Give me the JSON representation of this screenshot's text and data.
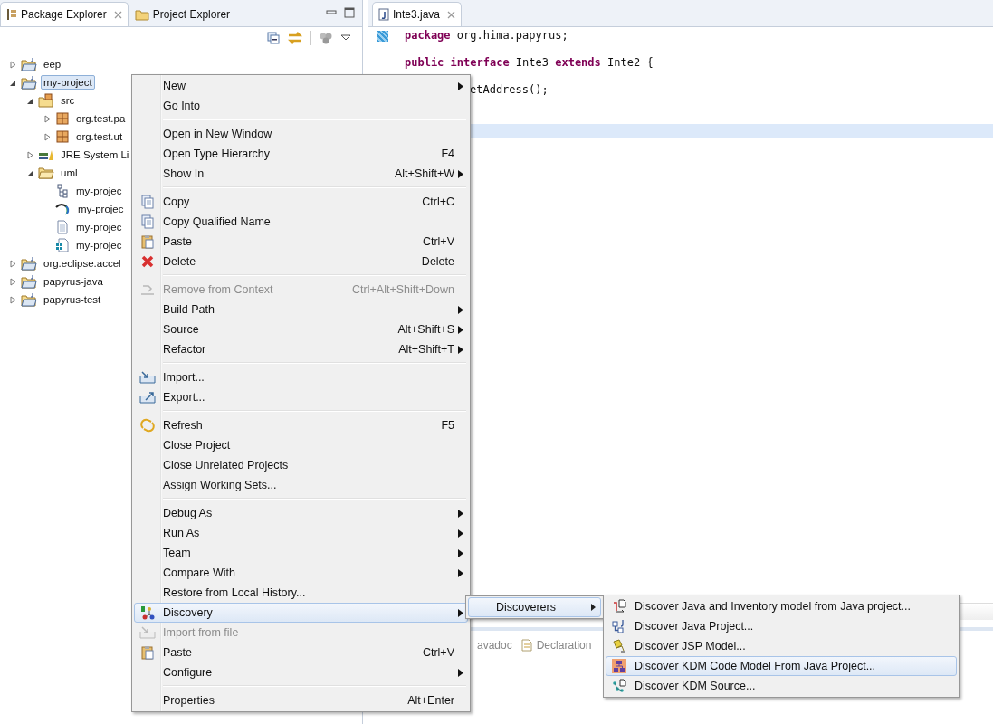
{
  "explorer": {
    "tabs": [
      {
        "label": "Package Explorer",
        "selected": true,
        "closable": true
      },
      {
        "label": "Project Explorer",
        "selected": false,
        "closable": false
      }
    ],
    "tree": [
      {
        "label": "eep",
        "kind": "project",
        "expanded": false,
        "selected": false
      },
      {
        "label": "my-project",
        "kind": "project",
        "expanded": true,
        "selected": true,
        "children": [
          {
            "label": "src",
            "kind": "source-folder",
            "expanded": true,
            "selected": false,
            "children": [
              {
                "label": "org.test.pa",
                "kind": "package",
                "expanded": false,
                "selected": false
              },
              {
                "label": "org.test.ut",
                "kind": "package",
                "expanded": false,
                "selected": false
              }
            ]
          },
          {
            "label": "JRE System Li",
            "kind": "library",
            "expanded": false,
            "selected": false
          },
          {
            "label": "uml",
            "kind": "folder",
            "expanded": true,
            "selected": false,
            "children": [
              {
                "label": "my-projec",
                "kind": "diagram",
                "selected": false
              },
              {
                "label": "my-projec",
                "kind": "model",
                "selected": false
              },
              {
                "label": "my-projec",
                "kind": "file",
                "selected": false
              },
              {
                "label": "my-projec",
                "kind": "notation",
                "selected": false
              }
            ]
          }
        ]
      },
      {
        "label": "org.eclipse.accel",
        "kind": "project",
        "expanded": false,
        "selected": false
      },
      {
        "label": "papyrus-java",
        "kind": "project",
        "expanded": false,
        "selected": false
      },
      {
        "label": "papyrus-test",
        "kind": "project",
        "expanded": false,
        "selected": false
      }
    ]
  },
  "editor": {
    "tab": {
      "label": "Inte3.java",
      "selected": true,
      "closable": true
    },
    "lines": [
      {
        "kind": "code",
        "current": false,
        "segments": [
          {
            "text": "package",
            "keyword": true
          },
          {
            "text": "org.hima.papyrus;",
            "keyword": false
          }
        ]
      },
      {
        "kind": "blank",
        "current": false
      },
      {
        "kind": "code",
        "current": false,
        "segments": [
          {
            "text": "public",
            "keyword": true
          },
          {
            "text": "interface",
            "keyword": true
          },
          {
            "text": "Inte3",
            "keyword": false
          },
          {
            "text": "extends",
            "keyword": true
          },
          {
            "text": "Inte2 {",
            "keyword": false
          }
        ]
      },
      {
        "kind": "blank",
        "current": false
      },
      {
        "kind": "partial",
        "current": false,
        "segments": [
          {
            "text": "etAddress();",
            "keyword": false
          }
        ]
      },
      {
        "kind": "blank",
        "current": false
      },
      {
        "kind": "blank",
        "current": false
      },
      {
        "kind": "blank",
        "current": true
      }
    ],
    "bottom_tabs": [
      {
        "label": "avadoc",
        "kind": "partial",
        "selected": false
      },
      {
        "label": "Declaration",
        "kind": "full",
        "selected": false
      }
    ]
  },
  "context_menu": {
    "groups": [
      [
        {
          "label": "New",
          "submenu": true,
          "disabled": false,
          "selected": false
        },
        {
          "label": "Go Into",
          "submenu": false,
          "disabled": false,
          "selected": false
        }
      ],
      [
        {
          "label": "Open in New Window",
          "submenu": false,
          "disabled": false,
          "selected": false
        },
        {
          "label": "Open Type Hierarchy",
          "shortcut": "F4",
          "submenu": false,
          "disabled": false,
          "selected": false
        },
        {
          "label": "Show In",
          "shortcut": "Alt+Shift+W",
          "submenu": true,
          "disabled": false,
          "selected": false
        }
      ],
      [
        {
          "label": "Copy",
          "shortcut": "Ctrl+C",
          "submenu": false,
          "disabled": false,
          "selected": false
        },
        {
          "label": "Copy Qualified Name",
          "submenu": false,
          "disabled": false,
          "selected": false
        },
        {
          "label": "Paste",
          "shortcut": "Ctrl+V",
          "submenu": false,
          "disabled": false,
          "selected": false
        },
        {
          "label": "Delete",
          "shortcut": "Delete",
          "submenu": false,
          "disabled": false,
          "selected": false
        }
      ],
      [
        {
          "label": "Remove from Context",
          "shortcut": "Ctrl+Alt+Shift+Down",
          "submenu": false,
          "disabled": true,
          "selected": false
        },
        {
          "label": "Build Path",
          "submenu": true,
          "disabled": false,
          "selected": false
        },
        {
          "label": "Source",
          "shortcut": "Alt+Shift+S",
          "submenu": true,
          "disabled": false,
          "selected": false
        },
        {
          "label": "Refactor",
          "shortcut": "Alt+Shift+T",
          "submenu": true,
          "disabled": false,
          "selected": false
        }
      ],
      [
        {
          "label": "Import...",
          "submenu": false,
          "disabled": false,
          "selected": false
        },
        {
          "label": "Export...",
          "submenu": false,
          "disabled": false,
          "selected": false
        }
      ],
      [
        {
          "label": "Refresh",
          "shortcut": "F5",
          "submenu": false,
          "disabled": false,
          "selected": false
        },
        {
          "label": "Close Project",
          "submenu": false,
          "disabled": false,
          "selected": false
        },
        {
          "label": "Close Unrelated Projects",
          "submenu": false,
          "disabled": false,
          "selected": false
        },
        {
          "label": "Assign Working Sets...",
          "submenu": false,
          "disabled": false,
          "selected": false
        }
      ],
      [
        {
          "label": "Debug As",
          "submenu": true,
          "disabled": false,
          "selected": false
        },
        {
          "label": "Run As",
          "submenu": true,
          "disabled": false,
          "selected": false
        },
        {
          "label": "Team",
          "submenu": true,
          "disabled": false,
          "selected": false
        },
        {
          "label": "Compare With",
          "submenu": true,
          "disabled": false,
          "selected": false
        },
        {
          "label": "Restore from Local History...",
          "submenu": false,
          "disabled": false,
          "selected": false
        },
        {
          "label": "Discovery",
          "submenu": true,
          "disabled": false,
          "selected": true
        },
        {
          "label": "Import from file",
          "submenu": false,
          "disabled": true,
          "selected": false
        },
        {
          "label": "Paste",
          "shortcut": "Ctrl+V",
          "submenu": false,
          "disabled": false,
          "selected": false
        },
        {
          "label": "Configure",
          "submenu": true,
          "disabled": false,
          "selected": false
        }
      ],
      [
        {
          "label": "Properties",
          "shortcut": "Alt+Enter",
          "submenu": false,
          "disabled": false,
          "selected": false
        }
      ]
    ]
  },
  "submenu": {
    "items": [
      {
        "label": "Discoverers",
        "submenu": true,
        "selected": true
      }
    ]
  },
  "discoverers_menu": {
    "items": [
      {
        "label": "Discover Java and Inventory model from Java project...",
        "selected": false
      },
      {
        "label": "Discover Java Project...",
        "selected": false
      },
      {
        "label": "Discover JSP Model...",
        "selected": false
      },
      {
        "label": "Discover KDM Code Model From Java Project...",
        "selected": true
      },
      {
        "label": "Discover KDM Source...",
        "selected": false
      }
    ]
  }
}
